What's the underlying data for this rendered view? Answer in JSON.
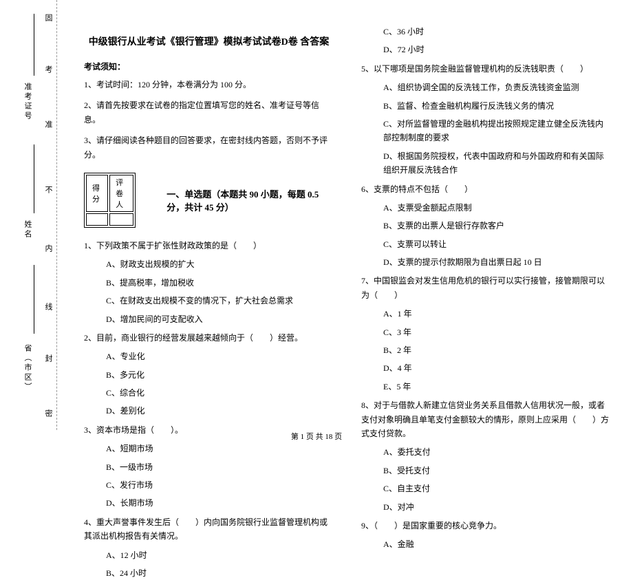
{
  "bindingMargin": {
    "labels": {
      "gu": "固",
      "kao": "考",
      "zhun": "准",
      "bu": "不",
      "nei": "内",
      "xian": "线",
      "feng": "封",
      "mi": "密"
    },
    "fields": {
      "zhunkaozheng": "准考证号",
      "xingming": "姓名",
      "sheng": "省（市区）"
    }
  },
  "title": "中级银行从业考试《银行管理》模拟考试试卷D卷 含答案",
  "noticeHeading": "考试须知：",
  "instructions": [
    "1、考试时间：120 分钟，本卷满分为 100 分。",
    "2、请首先按要求在试卷的指定位置填写您的姓名、准考证号等信息。",
    "3、请仔细阅读各种题目的回答要求，在密封线内答题，否则不予评分。"
  ],
  "scoreBox": {
    "score": "得分",
    "grader": "评卷人"
  },
  "sectionTitle": "一、单选题（本题共 90 小题，每题 0.5 分，共计 45 分）",
  "leftQuestions": [
    {
      "stem": "1、下列政策不属于扩张性财政政策的是（　　）",
      "options": [
        "A、财政支出规模的扩大",
        "B、提高税率，增加税收",
        "C、在财政支出规模不变的情况下，扩大社会总需求",
        "D、增加民间的可支配收入"
      ]
    },
    {
      "stem": "2、目前，商业银行的经营发展越来越倾向于（　　）经营。",
      "options": [
        "A、专业化",
        "B、多元化",
        "C、综合化",
        "D、差别化"
      ]
    },
    {
      "stem": "3、资本市场是指（　　）。",
      "options": [
        "A、短期市场",
        "B、一级市场",
        "C、发行市场",
        "D、长期市场"
      ]
    },
    {
      "stem": "4、重大声誉事件发生后（　　）内向国务院银行业监督管理机构或其派出机构报告有关情况。",
      "options": [
        "A、12 小时",
        "B、24 小时"
      ]
    }
  ],
  "rightQuestions": [
    {
      "stem": "",
      "options": [
        "C、36 小时",
        "D、72 小时"
      ]
    },
    {
      "stem": "5、以下哪项是国务院金融监督管理机构的反洗钱职责（　　）",
      "options": [
        "A、组织协调全国的反洗钱工作，负责反洗钱资金监测",
        "B、监督、检查金融机构履行反洗钱义务的情况",
        "C、对所监督管理的金融机构提出按照规定建立健全反洗钱内部控制制度的要求",
        "D、根据国务院授权，代表中国政府和与外国政府和有关国际组织开展反洗钱合作"
      ]
    },
    {
      "stem": "6、支票的特点不包括（　　）",
      "options": [
        "A、支票受金额起点限制",
        "B、支票的出票人是银行存款客户",
        "C、支票可以转让",
        "D、支票的提示付款期限为自出票日起 10 日"
      ]
    },
    {
      "stem": "7、中国银监会对发生信用危机的银行可以实行接管，接管期限可以为（　　）",
      "options": [
        "A、1 年",
        "C、3 年",
        "B、2 年",
        "D、4 年",
        "E、5 年"
      ]
    },
    {
      "stem": "8、对于与借款人新建立信贷业务关系且借款人信用状况一般，或者支付对象明确且单笔支付金额较大的情形，原则上应采用（　　）方式支付贷款。",
      "options": [
        "A、委托支付",
        "B、受托支付",
        "C、自主支付",
        "D、对冲"
      ]
    },
    {
      "stem": "9、（　　）是国家重要的核心竞争力。",
      "options": [
        "A、金融"
      ]
    }
  ],
  "footer": "第 1 页 共 18 页"
}
